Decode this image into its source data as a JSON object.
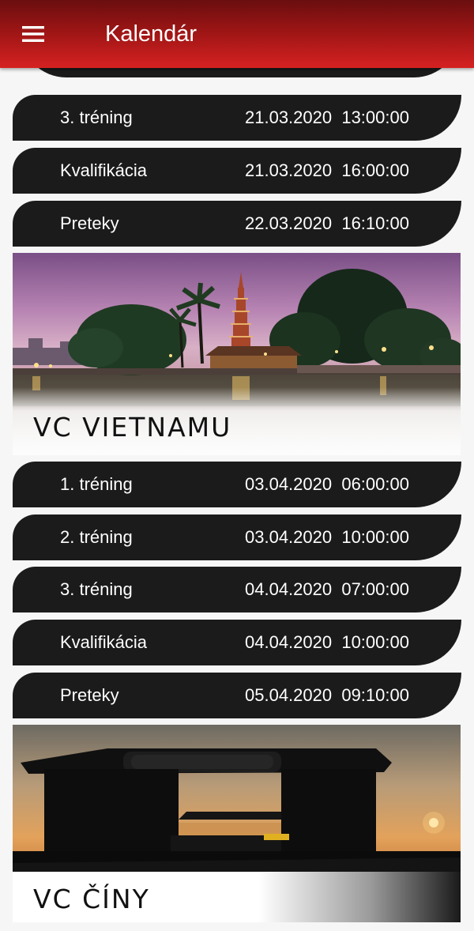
{
  "appbar": {
    "menu_icon": "hamburger-menu-icon",
    "title": "Kalendár",
    "accent_color": "#c81c1c"
  },
  "sessions_top": [
    {
      "name": "3. tréning",
      "datetime": "21.03.2020  13:00:00"
    },
    {
      "name": "Kvalifikácia",
      "datetime": "21.03.2020  16:00:00"
    },
    {
      "name": "Preteky",
      "datetime": "22.03.2020  16:10:00"
    }
  ],
  "races": [
    {
      "banner_caption": "VC VIETNAMU",
      "sessions": [
        {
          "name": "1. tréning",
          "datetime": "03.04.2020  06:00:00"
        },
        {
          "name": "2. tréning",
          "datetime": "03.04.2020  10:00:00"
        },
        {
          "name": "3. tréning",
          "datetime": "04.04.2020  07:00:00"
        },
        {
          "name": "Kvalifikácia",
          "datetime": "04.04.2020  10:00:00"
        },
        {
          "name": "Preteky",
          "datetime": "05.04.2020  09:10:00"
        }
      ]
    },
    {
      "banner_caption": "VC ČÍNY",
      "sessions": []
    }
  ],
  "colors": {
    "row_background": "#1b1b1b",
    "row_text": "#ffffff",
    "page_background": "#f6f6f6"
  }
}
